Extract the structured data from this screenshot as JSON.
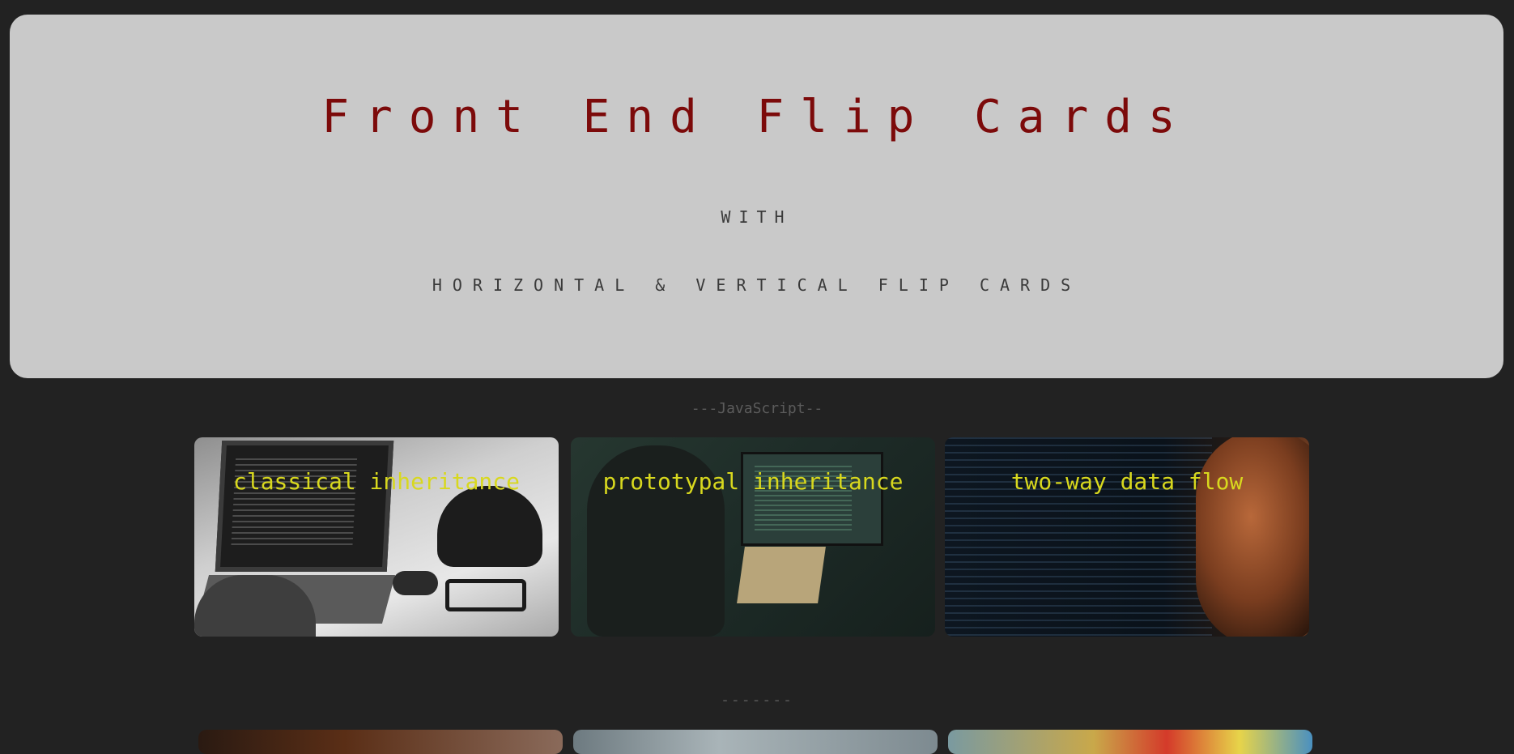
{
  "hero": {
    "title": "Front End Flip Cards",
    "with": "WITH",
    "subtitle": "HORIZONTAL & VERTICAL FLIP CARDS"
  },
  "sections": {
    "first_label": "---JavaScript--",
    "second_label": "-------"
  },
  "cards": [
    {
      "title": "classical inheritance",
      "image": "laptop-desk-photo"
    },
    {
      "title": "prototypal inheritance",
      "image": "developer-at-monitor-photo"
    },
    {
      "title": "two-way data flow",
      "image": "code-screen-photo"
    }
  ],
  "second_row_cards": [
    {
      "image": "warm-blur-photo"
    },
    {
      "image": "window-photo"
    },
    {
      "image": "colorful-photo"
    }
  ],
  "colors": {
    "page_background": "#222222",
    "hero_background": "#c9c9c9",
    "title_color": "#7c0a0a",
    "card_title_color": "#d8d81e"
  }
}
